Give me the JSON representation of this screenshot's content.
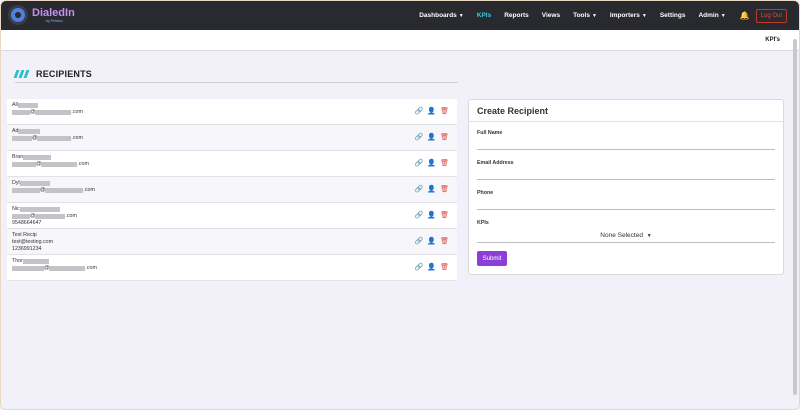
{
  "app": {
    "logo_text": "DialedIn",
    "logo_sub": "by Peloton"
  },
  "nav": {
    "items": [
      {
        "label": "Dashboards",
        "caret": true,
        "active": false
      },
      {
        "label": "KPIs",
        "caret": false,
        "active": true
      },
      {
        "label": "Reports",
        "caret": false,
        "active": false
      },
      {
        "label": "Views",
        "caret": false,
        "active": false
      },
      {
        "label": "Tools",
        "caret": true,
        "active": false
      },
      {
        "label": "Importers",
        "caret": true,
        "active": false
      },
      {
        "label": "Settings",
        "caret": false,
        "active": false
      },
      {
        "label": "Admin",
        "caret": true,
        "active": false
      }
    ],
    "logout_label": "Log Out"
  },
  "breadcrumb": "KPI's",
  "page_title": "RECIPIENTS",
  "recipients": [
    {
      "name": "All",
      "email_suffix": ".com",
      "phone": ""
    },
    {
      "name": "Ad",
      "email_suffix": ".com",
      "phone": ""
    },
    {
      "name": "Bran",
      "email_suffix": ".com",
      "phone": ""
    },
    {
      "name": "Dyl",
      "email_suffix": ".com",
      "phone": ""
    },
    {
      "name": "Nic",
      "email_suffix": ".com",
      "phone": "9548664647"
    },
    {
      "name": "Test Recip",
      "email": "test@testing.com",
      "phone": "1236991234"
    },
    {
      "name": "Thor",
      "email_suffix": ".com",
      "phone": ""
    }
  ],
  "create": {
    "title": "Create Recipient",
    "full_name_label": "Full Name",
    "email_label": "Email Address",
    "phone_label": "Phone",
    "kpis_label": "KPIs",
    "kpis_value": "None Selected",
    "submit_label": "Submit"
  },
  "colors": {
    "nav_bg": "#282a2f",
    "accent": "#2cc0cb",
    "submit": "#8c3fd6",
    "trash": "#d54b45"
  }
}
